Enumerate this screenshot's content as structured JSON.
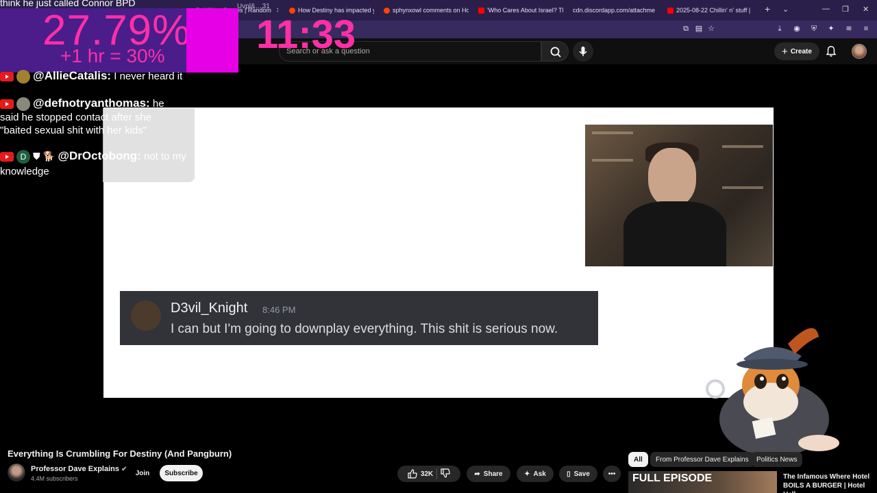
{
  "browser": {
    "tabs": [
      {
        "label": "Wiki… Games | Random",
        "color": "#7a5cff"
      },
      {
        "label": "How Destiny has impacted y",
        "color": "#ff4500"
      },
      {
        "label": "sphynxowl comments on Ho",
        "color": "#ff4500"
      },
      {
        "label": "'Who Cares About Israel? Th",
        "color": "#ff0000"
      },
      {
        "label": "cdn.discordapp.com/attachme",
        "color": "#5865f2"
      },
      {
        "label": "2025-08-22 Chillin' n' stuff |",
        "color": "#ff0000"
      }
    ],
    "address_fragment": "Uvpl&…31",
    "new_tab": "+"
  },
  "youtube": {
    "search_placeholder": "Search or ask a question",
    "create_label": "Create"
  },
  "overlay": {
    "percent": "27.79%",
    "bonus": "+1 hr = 30%",
    "clock": "11:33",
    "top_line": "think he just called Connor BPD"
  },
  "chat": [
    {
      "user": "@AllieCatalis:",
      "message": "I never heard it"
    },
    {
      "user": "@defnotryanthomas:",
      "message": "he said he stopped contact after she \"baited sexual shit with her kids\""
    },
    {
      "user": "@DrOctobong:",
      "message": "not to my knowledge",
      "initial": "D"
    }
  ],
  "discord_message": {
    "username": "D3vil_Knight",
    "time": "8:46 PM",
    "text": "I can but I'm going to downplay everything. This shit is serious now."
  },
  "video": {
    "title": "Everything Is Crumbling For Destiny (And Pangburn)",
    "channel": "Professor Dave Explains",
    "subscribers": "4.4M subscribers",
    "join_label": "Join",
    "subscribe_label": "Subscribe",
    "likes": "32K",
    "share_label": "Share",
    "ask_label": "Ask",
    "save_label": "Save"
  },
  "chips": [
    "All",
    "From Professor Dave Explains",
    "Politics News"
  ],
  "recommendation": {
    "thumb_text": "FULL EPISODE",
    "title": "The Infamous Where Hotel BOILS A BURGER | Hotel Hell"
  }
}
